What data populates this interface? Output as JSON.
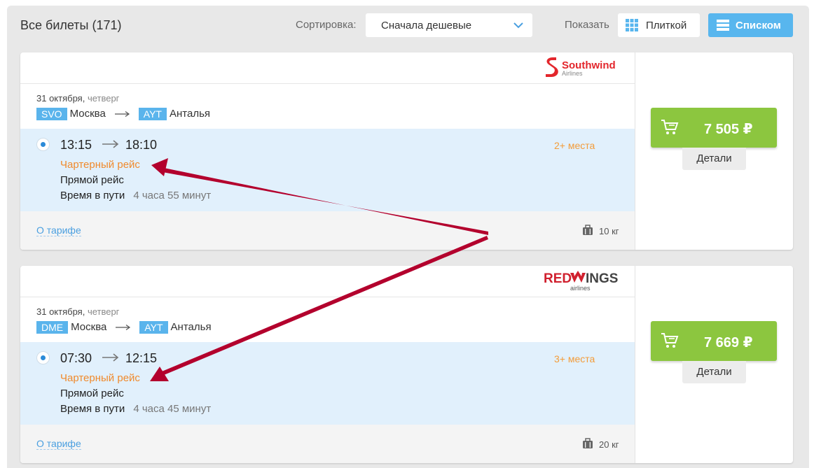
{
  "header": {
    "all_tickets": "Все билеты (171)",
    "sort_label": "Сортировка:",
    "sort_value": "Сначала дешевые",
    "show_label": "Показать",
    "view_tile": "Плиткой",
    "view_list": "Списком",
    "active_view": "list"
  },
  "colors": {
    "accent_blue": "#58b6ee",
    "iata_blue": "#5ab4ec",
    "buy_green": "#8cc63f",
    "charter_orange": "#f08a2c",
    "segment_bg": "#e1f0fc",
    "annotation_arrow": "#b3002d"
  },
  "tickets": [
    {
      "airline": {
        "name": "Southwind",
        "sub": "Airlines",
        "logo_icon": "southwind-s-logo",
        "logo_color": "#e3262c"
      },
      "date": "31 октября,",
      "weekday": "четверг",
      "from_code": "SVO",
      "from_city": "Москва",
      "to_code": "AYT",
      "to_city": "Анталья",
      "departure": "13:15",
      "arrival": "18:10",
      "seats": "2+ места",
      "charter": "Чартерный рейс",
      "direct": "Прямой рейс",
      "duration_label": "Время в пути",
      "duration": "4 часа 55 минут",
      "tariff_link": "О тарифе",
      "baggage": "10 кг",
      "price": "7 505 ₽",
      "details": "Детали"
    },
    {
      "airline": {
        "name_red": "RED",
        "name_dark": "INGS",
        "sub": "airlines",
        "logo_icon": "redwings-logo",
        "logo_color": "#d0202e"
      },
      "date": "31 октября,",
      "weekday": "четверг",
      "from_code": "DME",
      "from_city": "Москва",
      "to_code": "AYT",
      "to_city": "Анталья",
      "departure": "07:30",
      "arrival": "12:15",
      "seats": "3+ места",
      "charter": "Чартерный рейс",
      "direct": "Прямой рейс",
      "duration_label": "Время в пути",
      "duration": "4 часа 45 минут",
      "tariff_link": "О тарифе",
      "baggage": "20 кг",
      "price": "7 669 ₽",
      "details": "Детали"
    }
  ],
  "annotation": {
    "type": "arrows",
    "target": "charter-label",
    "count": 2
  }
}
